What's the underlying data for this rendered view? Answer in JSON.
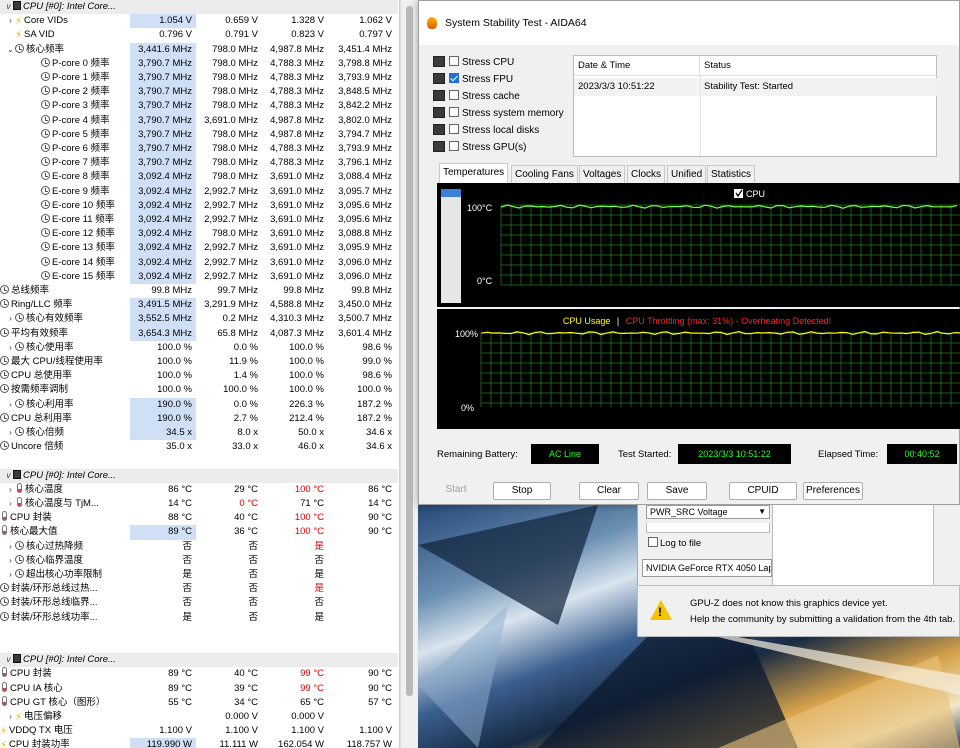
{
  "hwinfo": {
    "rows": [
      {
        "k": "group",
        "label": "CPU [#0]: Intel Core..."
      },
      {
        "k": "row",
        "exp": ">",
        "icon": "bolt",
        "indent": 0,
        "label": "Core VIDs",
        "v": [
          "1.054 V",
          "0.659 V",
          "1.328 V",
          "1.062 V"
        ],
        "hl": true
      },
      {
        "k": "row",
        "exp": "",
        "icon": "bolt",
        "indent": 0,
        "label": "SA VID",
        "v": [
          "0.796 V",
          "0.791 V",
          "0.823 V",
          "0.797 V"
        ]
      },
      {
        "k": "row",
        "exp": "v",
        "icon": "clock",
        "indent": 0,
        "label": "核心频率",
        "v": [
          "3,441.6 MHz",
          "798.0 MHz",
          "4,987.8 MHz",
          "3,451.4 MHz"
        ],
        "hl": true
      },
      {
        "k": "row",
        "exp": "",
        "icon": "clock",
        "indent": 1,
        "label": "P-core 0 频率",
        "v": [
          "3,790.7 MHz",
          "798.0 MHz",
          "4,788.3 MHz",
          "3,798.8 MHz"
        ],
        "hl": true
      },
      {
        "k": "row",
        "exp": "",
        "icon": "clock",
        "indent": 1,
        "label": "P-core 1 频率",
        "v": [
          "3,790.7 MHz",
          "798.0 MHz",
          "4,788.3 MHz",
          "3,793.9 MHz"
        ],
        "hl": true
      },
      {
        "k": "row",
        "exp": "",
        "icon": "clock",
        "indent": 1,
        "label": "P-core 2 频率",
        "v": [
          "3,790.7 MHz",
          "798.0 MHz",
          "4,788.3 MHz",
          "3,848.5 MHz"
        ],
        "hl": true
      },
      {
        "k": "row",
        "exp": "",
        "icon": "clock",
        "indent": 1,
        "label": "P-core 3 频率",
        "v": [
          "3,790.7 MHz",
          "798.0 MHz",
          "4,788.3 MHz",
          "3,842.2 MHz"
        ],
        "hl": true
      },
      {
        "k": "row",
        "exp": "",
        "icon": "clock",
        "indent": 1,
        "label": "P-core 4 频率",
        "v": [
          "3,790.7 MHz",
          "3,691.0 MHz",
          "4,987.8 MHz",
          "3,802.0 MHz"
        ],
        "hl": true
      },
      {
        "k": "row",
        "exp": "",
        "icon": "clock",
        "indent": 1,
        "label": "P-core 5 频率",
        "v": [
          "3,790.7 MHz",
          "798.0 MHz",
          "4,987.8 MHz",
          "3,794.7 MHz"
        ],
        "hl": true
      },
      {
        "k": "row",
        "exp": "",
        "icon": "clock",
        "indent": 1,
        "label": "P-core 6 频率",
        "v": [
          "3,790.7 MHz",
          "798.0 MHz",
          "4,788.3 MHz",
          "3,793.9 MHz"
        ],
        "hl": true
      },
      {
        "k": "row",
        "exp": "",
        "icon": "clock",
        "indent": 1,
        "label": "P-core 7 频率",
        "v": [
          "3,790.7 MHz",
          "798.0 MHz",
          "4,788.3 MHz",
          "3,796.1 MHz"
        ],
        "hl": true
      },
      {
        "k": "row",
        "exp": "",
        "icon": "clock",
        "indent": 1,
        "label": "E-core 8 频率",
        "v": [
          "3,092.4 MHz",
          "798.0 MHz",
          "3,691.0 MHz",
          "3,088.4 MHz"
        ],
        "hl": true
      },
      {
        "k": "row",
        "exp": "",
        "icon": "clock",
        "indent": 1,
        "label": "E-core 9 频率",
        "v": [
          "3,092.4 MHz",
          "2,992.7 MHz",
          "3,691.0 MHz",
          "3,095.7 MHz"
        ],
        "hl": true
      },
      {
        "k": "row",
        "exp": "",
        "icon": "clock",
        "indent": 1,
        "label": "E-core 10 频率",
        "v": [
          "3,092.4 MHz",
          "2,992.7 MHz",
          "3,691.0 MHz",
          "3,095.6 MHz"
        ],
        "hl": true
      },
      {
        "k": "row",
        "exp": "",
        "icon": "clock",
        "indent": 1,
        "label": "E-core 11 频率",
        "v": [
          "3,092.4 MHz",
          "2,992.7 MHz",
          "3,691.0 MHz",
          "3,095.6 MHz"
        ],
        "hl": true
      },
      {
        "k": "row",
        "exp": "",
        "icon": "clock",
        "indent": 1,
        "label": "E-core 12 频率",
        "v": [
          "3,092.4 MHz",
          "798.0 MHz",
          "3,691.0 MHz",
          "3,088.8 MHz"
        ],
        "hl": true
      },
      {
        "k": "row",
        "exp": "",
        "icon": "clock",
        "indent": 1,
        "label": "E-core 13 频率",
        "v": [
          "3,092.4 MHz",
          "2,992.7 MHz",
          "3,691.0 MHz",
          "3,095.9 MHz"
        ],
        "hl": true
      },
      {
        "k": "row",
        "exp": "",
        "icon": "clock",
        "indent": 1,
        "label": "E-core 14 频率",
        "v": [
          "3,092.4 MHz",
          "2,992.7 MHz",
          "3,691.0 MHz",
          "3,096.0 MHz"
        ],
        "hl": true
      },
      {
        "k": "row",
        "exp": "",
        "icon": "clock",
        "indent": 1,
        "label": "E-core 15 频率",
        "v": [
          "3,092.4 MHz",
          "2,992.7 MHz",
          "3,691.0 MHz",
          "3,096.0 MHz"
        ],
        "hl": true
      },
      {
        "k": "row",
        "exp": "",
        "icon": "clock",
        "indent": -1,
        "label": "总线频率",
        "v": [
          "99.8 MHz",
          "99.7 MHz",
          "99.8 MHz",
          "99.8 MHz"
        ]
      },
      {
        "k": "row",
        "exp": "",
        "icon": "clock",
        "indent": -1,
        "label": "Ring/LLC 频率",
        "v": [
          "3,491.5 MHz",
          "3,291.9 MHz",
          "4,588.8 MHz",
          "3,450.0 MHz"
        ],
        "hl": true
      },
      {
        "k": "row",
        "exp": ">",
        "icon": "clock",
        "indent": 0,
        "label": "核心有效频率",
        "v": [
          "3,552.5 MHz",
          "0.2 MHz",
          "4,310.3 MHz",
          "3,500.7 MHz"
        ],
        "hl": true
      },
      {
        "k": "row",
        "exp": "",
        "icon": "clock",
        "indent": -1,
        "label": "平均有效频率",
        "v": [
          "3,654.3 MHz",
          "65.8 MHz",
          "4,087.3 MHz",
          "3,601.4 MHz"
        ],
        "hl": true
      },
      {
        "k": "row",
        "exp": ">",
        "icon": "clock",
        "indent": 0,
        "label": "核心使用率",
        "v": [
          "100.0 %",
          "0.0 %",
          "100.0 %",
          "98.6 %"
        ]
      },
      {
        "k": "row",
        "exp": "",
        "icon": "clock",
        "indent": -1,
        "label": "最大 CPU/线程使用率",
        "v": [
          "100.0 %",
          "11.9 %",
          "100.0 %",
          "99.0 %"
        ]
      },
      {
        "k": "row",
        "exp": "",
        "icon": "clock",
        "indent": -1,
        "label": "CPU 总使用率",
        "v": [
          "100.0 %",
          "1.4 %",
          "100.0 %",
          "98.6 %"
        ]
      },
      {
        "k": "row",
        "exp": "",
        "icon": "clock",
        "indent": -1,
        "label": "按需频率调制",
        "v": [
          "100.0 %",
          "100.0 %",
          "100.0 %",
          "100.0 %"
        ]
      },
      {
        "k": "row",
        "exp": ">",
        "icon": "clock",
        "indent": 0,
        "label": "核心利用率",
        "v": [
          "190.0 %",
          "0.0 %",
          "226.3 %",
          "187.2 %"
        ],
        "hl": true
      },
      {
        "k": "row",
        "exp": "",
        "icon": "clock",
        "indent": -1,
        "label": "CPU 总利用率",
        "v": [
          "190.0 %",
          "2.7 %",
          "212.4 %",
          "187.2 %"
        ],
        "hl": true
      },
      {
        "k": "row",
        "exp": ">",
        "icon": "clock",
        "indent": 0,
        "label": "核心倍频",
        "v": [
          "34.5 x",
          "8.0 x",
          "50.0 x",
          "34.6 x"
        ],
        "hl": true
      },
      {
        "k": "row",
        "exp": "",
        "icon": "clock",
        "indent": -1,
        "label": "Uncore 倍频",
        "v": [
          "35.0 x",
          "33.0 x",
          "46.0 x",
          "34.6 x"
        ]
      },
      {
        "k": "sep"
      },
      {
        "k": "group",
        "label": "CPU [#0]: Intel Core..."
      },
      {
        "k": "row",
        "exp": ">",
        "icon": "therm",
        "indent": 0,
        "label": "核心温度",
        "v": [
          "86 °C",
          "29 °C",
          "100 °C",
          "86 °C"
        ],
        "red": [
          2
        ]
      },
      {
        "k": "row",
        "exp": ">",
        "icon": "therm",
        "indent": 0,
        "label": "核心温度与 TjM...",
        "v": [
          "14 °C",
          "0 °C",
          "71 °C",
          "14 °C"
        ],
        "red": [
          1
        ]
      },
      {
        "k": "row",
        "exp": "",
        "icon": "therm",
        "indent": -1,
        "label": "CPU 封装",
        "v": [
          "88 °C",
          "40 °C",
          "100 °C",
          "90 °C"
        ],
        "red": [
          2
        ]
      },
      {
        "k": "row",
        "exp": "",
        "icon": "therm",
        "indent": -1,
        "label": "核心最大值",
        "v": [
          "89 °C",
          "36 °C",
          "100 °C",
          "90 °C"
        ],
        "red": [
          2
        ],
        "hl": true
      },
      {
        "k": "row",
        "exp": ">",
        "icon": "clock",
        "indent": 0,
        "label": "核心过热降频",
        "v": [
          "否",
          "否",
          "是",
          ""
        ],
        "red": [
          2
        ]
      },
      {
        "k": "row",
        "exp": ">",
        "icon": "clock",
        "indent": 0,
        "label": "核心临界温度",
        "v": [
          "否",
          "否",
          "否",
          ""
        ]
      },
      {
        "k": "row",
        "exp": ">",
        "icon": "clock",
        "indent": 0,
        "label": "超出核心功率限制",
        "v": [
          "是",
          "否",
          "是",
          ""
        ]
      },
      {
        "k": "row",
        "exp": "",
        "icon": "clock",
        "indent": -1,
        "label": "封装/环形总线过热...",
        "v": [
          "否",
          "否",
          "是",
          ""
        ],
        "red": [
          2
        ]
      },
      {
        "k": "row",
        "exp": "",
        "icon": "clock",
        "indent": -1,
        "label": "封装/环形总线临界...",
        "v": [
          "否",
          "否",
          "否",
          ""
        ]
      },
      {
        "k": "row",
        "exp": "",
        "icon": "clock",
        "indent": -1,
        "label": "封装/环形总线功率...",
        "v": [
          "是",
          "否",
          "是",
          ""
        ]
      },
      {
        "k": "sep"
      },
      {
        "k": "sep"
      },
      {
        "k": "group",
        "label": "CPU [#0]: Intel Core..."
      },
      {
        "k": "row",
        "exp": "",
        "icon": "therm",
        "indent": -1,
        "label": "CPU 封装",
        "v": [
          "89 °C",
          "40 °C",
          "99 °C",
          "90 °C"
        ],
        "red": [
          2
        ]
      },
      {
        "k": "row",
        "exp": "",
        "icon": "therm",
        "indent": -1,
        "label": "CPU IA 核心",
        "v": [
          "89 °C",
          "39 °C",
          "99 °C",
          "90 °C"
        ],
        "red": [
          2
        ]
      },
      {
        "k": "row",
        "exp": "",
        "icon": "therm",
        "indent": -1,
        "label": "CPU GT 核心（图形）",
        "v": [
          "55 °C",
          "34 °C",
          "65 °C",
          "57 °C"
        ]
      },
      {
        "k": "row",
        "exp": ">",
        "icon": "bolt",
        "indent": 0,
        "label": "电压偏移",
        "v": [
          "",
          "0.000 V",
          "0.000 V",
          ""
        ]
      },
      {
        "k": "row",
        "exp": "",
        "icon": "bolt",
        "indent": -1,
        "label": "VDDQ TX 电压",
        "v": [
          "1.100 V",
          "1.100 V",
          "1.100 V",
          "1.100 V"
        ]
      },
      {
        "k": "row",
        "exp": "",
        "icon": "bolt",
        "indent": -1,
        "label": "CPU 封装功率",
        "v": [
          "119.990 W",
          "11.111 W",
          "162.054 W",
          "118.757 W"
        ],
        "hl": true
      }
    ]
  },
  "aida": {
    "title": "System Stability Test - AIDA64",
    "stress": [
      {
        "label": "Stress CPU",
        "checked": false,
        "icon": "cpu-icon"
      },
      {
        "label": "Stress FPU",
        "checked": true,
        "icon": "fpu-icon"
      },
      {
        "label": "Stress cache",
        "checked": false,
        "icon": "cache-icon"
      },
      {
        "label": "Stress system memory",
        "checked": false,
        "icon": "memory-icon"
      },
      {
        "label": "Stress local disks",
        "checked": false,
        "icon": "disk-icon"
      },
      {
        "label": "Stress GPU(s)",
        "checked": false,
        "icon": "gpu-icon"
      }
    ],
    "status_headers": {
      "date": "Date & Time",
      "status": "Status"
    },
    "status_row": {
      "date": "2023/3/3 10:51:22",
      "status": "Stability Test: Started"
    },
    "tabs": [
      "Temperatures",
      "Cooling Fans",
      "Voltages",
      "Clocks",
      "Unified",
      "Statistics"
    ],
    "active_tab": 0,
    "temp_graph": {
      "legend": "CPU",
      "ymax_label": "100°C",
      "ymin_label": "0°C",
      "line_level": 0.98
    },
    "usage_graph": {
      "title_a": "CPU Usage",
      "sep": "|",
      "title_b": "CPU Throttling (max: 31%) - Overheating Detected!",
      "ymax_label": "100%",
      "ymin_label": "0%",
      "line_level": 1.0
    },
    "footer": {
      "battery_label": "Remaining Battery:",
      "battery_value": "AC Line",
      "started_label": "Test Started:",
      "started_value": "2023/3/3 10:51:22",
      "elapsed_label": "Elapsed Time:",
      "elapsed_value": "00:40:52"
    },
    "buttons": {
      "start": "Start",
      "stop": "Stop",
      "clear": "Clear",
      "save": "Save",
      "cpuid": "CPUID",
      "preferences": "Preferences"
    },
    "colors": {
      "grid": "#1f7a1f",
      "line": "#7cff4a",
      "yellow": "#ffff00",
      "throttle": "#ff2020",
      "digital": "#20ff20"
    }
  },
  "gpuz": {
    "combo": "PWR_SRC Voltage",
    "log_label": "Log to file",
    "gpu_name": "NVIDIA GeForce RTX 4050 Lap",
    "notice_line1": "GPU-Z does not know this graphics device yet.",
    "notice_line2": "Help the community by submitting a validation from the 4th tab."
  }
}
